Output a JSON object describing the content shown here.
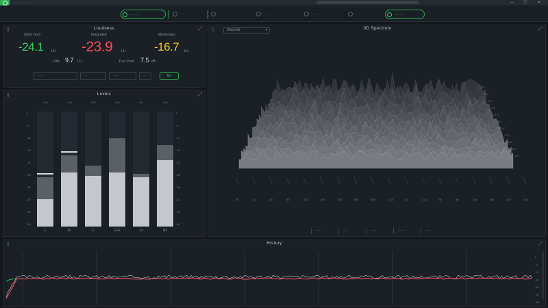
{
  "app": {
    "name": "···· ···· ···"
  },
  "window": {
    "controls": [
      "—",
      "☐",
      "✕"
    ]
  },
  "toolbar": {
    "tabs": [
      {
        "label": "······",
        "icon": "gauge-icon"
      },
      {
        "label": "·····",
        "icon": "meter-icon"
      },
      {
        "label": "······",
        "icon": "spectrum-icon"
      },
      {
        "label": "·····",
        "icon": "history-icon"
      },
      {
        "label": "·······",
        "icon": "settings-icon"
      },
      {
        "label": "······",
        "icon": "save-icon"
      },
      {
        "label": "·······",
        "icon": "power-icon"
      }
    ]
  },
  "loudness": {
    "title": "Loudness",
    "readings": [
      {
        "label": "Short Term",
        "value": "-24.1",
        "unit": "LU",
        "color": "#3ccf63"
      },
      {
        "label": "Integrated",
        "value": "-23.9",
        "unit": "LU",
        "color": "#ff4a5e"
      },
      {
        "label": "Momentary",
        "value": "-16.7",
        "unit": "LU",
        "color": "#f0c42a"
      }
    ],
    "range": {
      "label": "LRA",
      "value": "9.7",
      "unit": "LU"
    },
    "truepeak": {
      "label": "True Peak",
      "value": "7.5",
      "unit": "dB"
    },
    "controls": {
      "target": "·····",
      "mode": "···",
      "window": "·····",
      "extra": "···",
      "action": "Go"
    }
  },
  "levels": {
    "title": "Levels",
    "scale_labels": [
      "0",
      "-6",
      "-12",
      "-18",
      "-24",
      "-30",
      "-36",
      "-42",
      "-48",
      "-60"
    ],
    "channels": [
      {
        "name": "L",
        "top": "-4.6",
        "upper": 0.43,
        "lower": 0.24,
        "peak": 0.45
      },
      {
        "name": "R",
        "top": "-4.9",
        "upper": 0.62,
        "lower": 0.47,
        "peak": 0.64
      },
      {
        "name": "C",
        "top": "-5.2",
        "upper": 0.53,
        "lower": 0.44,
        "peak": 0
      },
      {
        "name": "LFE",
        "top": "-4.6",
        "upper": 0.77,
        "lower": 0.47,
        "peak": 0
      },
      {
        "name": "Ls",
        "top": "-5.1",
        "upper": 0.46,
        "lower": 0.43,
        "peak": 0
      },
      {
        "name": "Rs",
        "top": "-4.8",
        "upper": 0.71,
        "lower": 0.58,
        "peak": 0
      }
    ]
  },
  "spectrum": {
    "title": "3D Spectrum",
    "mode_select": "Waterfall",
    "freq_ticks": [
      "20",
      "31",
      "50",
      "80",
      "125",
      "200",
      "315",
      "500",
      "800",
      "1.2k",
      "2k",
      "3.1k",
      "5k",
      "8k",
      "12k",
      "16k",
      "20k",
      "22k"
    ],
    "depth_ticks": [
      "0.0",
      "0.5",
      "1.0",
      "1.5",
      "2.0",
      "2.5",
      "3.0",
      "3.5",
      "4.0",
      "4.5",
      "5.0"
    ],
    "tabs": [
      "·····",
      "····",
      "·····",
      "······",
      "·····"
    ]
  },
  "history": {
    "title": "History",
    "y_ticks": [
      "0",
      "-6",
      "-12",
      "-18",
      "-24",
      "-30",
      "-36"
    ]
  }
}
